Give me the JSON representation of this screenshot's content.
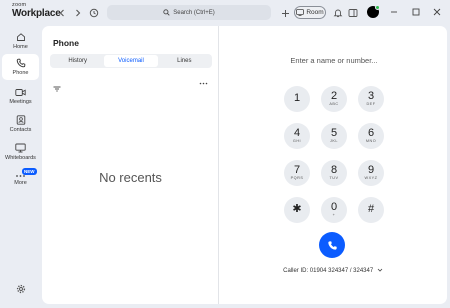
{
  "titlebar": {
    "logo_line1": "zoom",
    "logo_line2": "Workplace",
    "search_label": "Search (Ctrl+E)",
    "room_label": "Room"
  },
  "sidebar": {
    "items": [
      {
        "label": "Home",
        "icon": "home-icon"
      },
      {
        "label": "Phone",
        "icon": "phone-icon"
      },
      {
        "label": "Meetings",
        "icon": "video-icon"
      },
      {
        "label": "Contacts",
        "icon": "contacts-icon"
      },
      {
        "label": "Whiteboards",
        "icon": "whiteboard-icon"
      },
      {
        "label": "More",
        "icon": "more-icon"
      }
    ],
    "new_badge": "NEW",
    "active": "Phone"
  },
  "phone": {
    "title": "Phone",
    "tabs": [
      "History",
      "Voicemail",
      "Lines"
    ],
    "active_tab": "Voicemail",
    "empty_text": "No recents"
  },
  "dialer": {
    "placeholder": "Enter a name or number...",
    "keys": [
      {
        "digit": "1",
        "sub": ""
      },
      {
        "digit": "2",
        "sub": "ABC"
      },
      {
        "digit": "3",
        "sub": "DEF"
      },
      {
        "digit": "4",
        "sub": "GHI"
      },
      {
        "digit": "5",
        "sub": "JKL"
      },
      {
        "digit": "6",
        "sub": "MNO"
      },
      {
        "digit": "7",
        "sub": "PQRS"
      },
      {
        "digit": "8",
        "sub": "TUV"
      },
      {
        "digit": "9",
        "sub": "WXYZ"
      },
      {
        "digit": "✱",
        "sub": ""
      },
      {
        "digit": "0",
        "sub": "+"
      },
      {
        "digit": "#",
        "sub": ""
      }
    ],
    "caller_id": "Caller ID: 01904 324347 / 324347"
  },
  "colors": {
    "accent": "#0b5cff",
    "presence": "#2fbd4e"
  }
}
